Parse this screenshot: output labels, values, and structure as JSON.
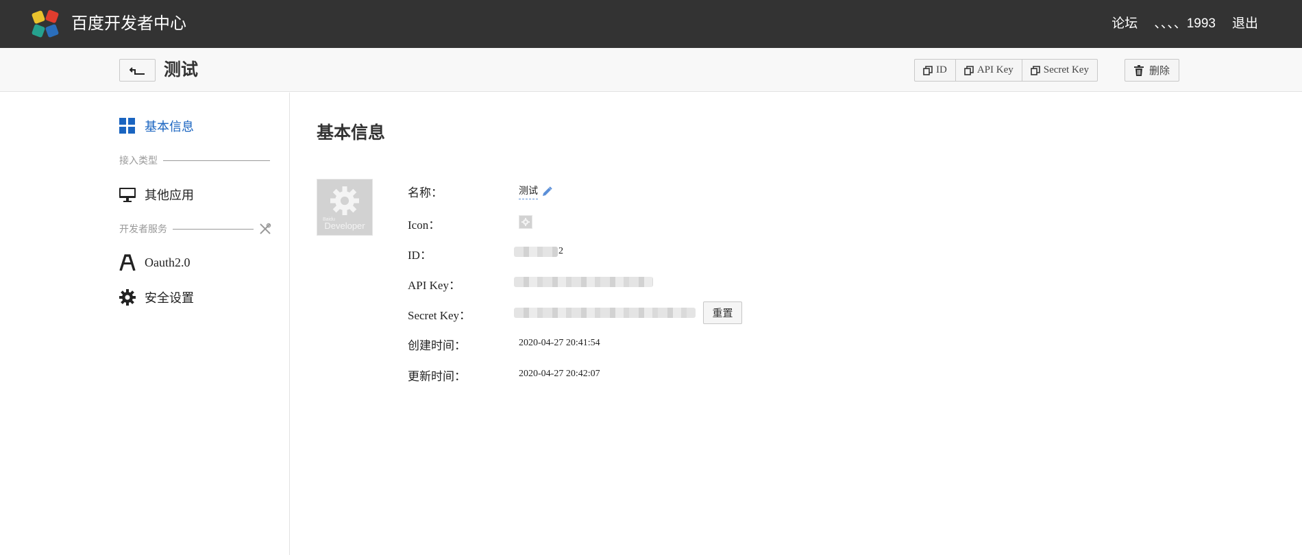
{
  "header": {
    "brand": "百度开发者中心",
    "nav": {
      "forum": "论坛",
      "user": "、、、、1993",
      "logout": "退出"
    }
  },
  "subheader": {
    "title": "测试",
    "buttons": {
      "id": "ID",
      "api_key": "API Key",
      "secret_key": "Secret Key",
      "delete": "删除"
    }
  },
  "sidebar": {
    "basic_info": "基本信息",
    "access_type": "接入类型",
    "other_app": "其他应用",
    "dev_service": "开发者服务",
    "oauth": "Oauth2.0",
    "security": "安全设置"
  },
  "main": {
    "title": "基本信息",
    "icon_text_small": "Baidu",
    "icon_text_dev": "Developer",
    "fields": {
      "name_label": "名称：",
      "name_value": "测试",
      "icon_label": "Icon：",
      "id_label": "ID：",
      "id_suffix": "2",
      "api_label": "API Key：",
      "secret_label": "Secret Key：",
      "created_label": "创建时间：",
      "created_value": "2020-04-27 20:41:54",
      "updated_label": "更新时间：",
      "updated_value": "2020-04-27 20:42:07"
    },
    "reset": "重置"
  },
  "colors": {
    "topbar": "#333333",
    "active": "#1a64c0",
    "edit": "#5b8fd8"
  }
}
